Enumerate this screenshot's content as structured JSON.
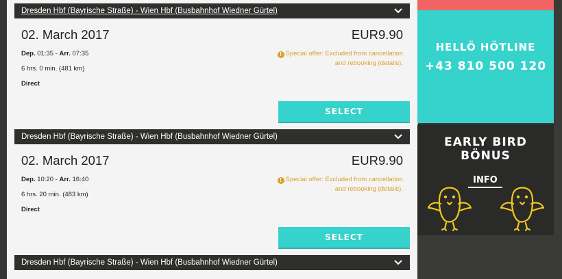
{
  "offers": [
    {
      "route": "Dresden Hbf (Bayrische Straße) - Wien Hbf (Busbahnhof Wiedner Gürtel)",
      "date": "02. March 2017",
      "price": "EUR9.90",
      "dep_label": "Dep.",
      "dep_time": "01:35",
      "arr_label": "Arr.",
      "arr_time": "07:35",
      "duration": "6 hrs. 0 min. (481 km)",
      "connection": "Direct",
      "special_offer": "Special offer: Excluded from cancellation and rebooking (details).",
      "select_label": "SELECT"
    },
    {
      "route": "Dresden Hbf (Bayrische Straße) - Wien Hbf (Busbahnhof Wiedner Gürtel)",
      "date": "02. March 2017",
      "price": "EUR9.90",
      "dep_label": "Dep.",
      "dep_time": "10:20",
      "arr_label": "Arr.",
      "arr_time": "16:40",
      "duration": "6 hrs. 20 min. (483 km)",
      "connection": "Direct",
      "special_offer": "Special offer: Excluded from cancellation and rebooking (details).",
      "select_label": "SELECT"
    }
  ],
  "next_route": "Dresden Hbf (Bayrische Straße) - Wien Hbf (Busbahnhof Wiedner Gürtel)",
  "sidebar": {
    "hotline_title": "HELLÖ HÖTLINE",
    "hotline_phone": "+43 810 500 120",
    "earlybird_title": "EARLY BIRD BÖNUS",
    "earlybird_info": "INFO"
  },
  "icons": {
    "route_toggle": "chevron-down-icon",
    "warning": "exclamation-circle-icon"
  },
  "colors": {
    "accent": "#36d3cc",
    "warning": "#d9a12c",
    "hotline_strip": "#f26363",
    "route_bar": "#2f2f2d",
    "chick": "#f2c71b"
  }
}
